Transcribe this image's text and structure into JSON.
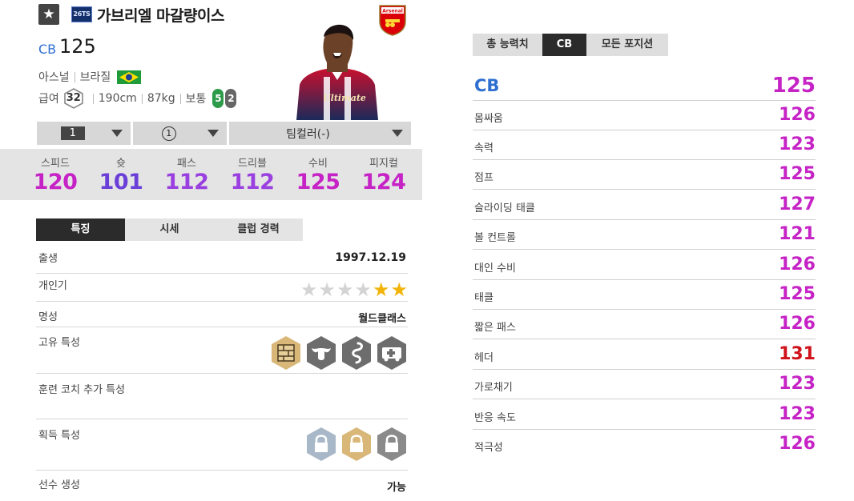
{
  "player": {
    "name": "가브리엘 마갈량이스",
    "season_badge": "26TS",
    "position": "CB",
    "ovr": "125",
    "club": "아스널",
    "nation": "브라질",
    "club_crest_text": "Arsenal",
    "salary": "32",
    "height": "190cm",
    "weight": "87kg",
    "body_type": "보통",
    "weak_foot_left": "5",
    "weak_foot_right": "2",
    "jersey_text": "Ultimate"
  },
  "controls": {
    "level": "1",
    "enhance": "1",
    "team_color": "팀컬러(-)"
  },
  "summary_stats": [
    {
      "label": "스피드",
      "value": "120",
      "color": "#c623c6"
    },
    {
      "label": "슛",
      "value": "101",
      "color": "#6a3fd8"
    },
    {
      "label": "패스",
      "value": "112",
      "color": "#9a3fe0"
    },
    {
      "label": "드리블",
      "value": "112",
      "color": "#9a3fe0"
    },
    {
      "label": "수비",
      "value": "125",
      "color": "#c623c6"
    },
    {
      "label": "피지컬",
      "value": "124",
      "color": "#c623c6"
    }
  ],
  "tabs": [
    "특징",
    "시세",
    "클럽 경력"
  ],
  "info": {
    "birth_label": "출생",
    "birth_value": "1997.12.19",
    "skill_label": "개인기",
    "skill_stars": 2,
    "skill_stars_total": 6,
    "fame_label": "명성",
    "fame_value": "월드클래스",
    "unique_traits_label": "고유 특성",
    "unique_traits_icons": [
      "wall-icon",
      "bull-icon",
      "snake-icon",
      "ambulance-icon"
    ],
    "coach_traits_label": "훈련 코치 추가 특성",
    "acquired_traits_label": "획득 특성",
    "acquired_traits_icons": [
      "lock-icon",
      "lock-icon",
      "lock-icon"
    ],
    "creation_label": "선수 생성",
    "creation_value": "가능"
  },
  "right_tabs": [
    "총 능력치",
    "CB",
    "모든 포지션"
  ],
  "detail_header": {
    "label": "CB",
    "value": "125"
  },
  "detail_stats": [
    {
      "label": "몸싸움",
      "value": "126"
    },
    {
      "label": "속력",
      "value": "123"
    },
    {
      "label": "점프",
      "value": "125"
    },
    {
      "label": "슬라이딩 태클",
      "value": "127"
    },
    {
      "label": "볼 컨트롤",
      "value": "121"
    },
    {
      "label": "대인 수비",
      "value": "126"
    },
    {
      "label": "태클",
      "value": "125"
    },
    {
      "label": "짧은 패스",
      "value": "126"
    },
    {
      "label": "헤더",
      "value": "131",
      "color": "#d0121b"
    },
    {
      "label": "가로채기",
      "value": "123"
    },
    {
      "label": "반응 속도",
      "value": "123"
    },
    {
      "label": "적극성",
      "value": "126"
    }
  ],
  "colors": {
    "accent_blue": "#2f6fd0",
    "stat_magenta": "#c623c6",
    "stat_red": "#d0121b",
    "star_gold": "#f2b40a",
    "star_gray": "#d4d4d4"
  }
}
